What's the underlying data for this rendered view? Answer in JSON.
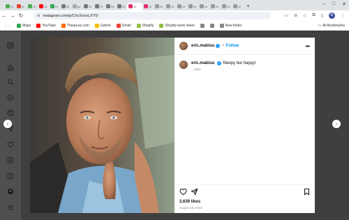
{
  "browser": {
    "tabs": [
      {
        "label": "Gr",
        "color": "#4caf50"
      },
      {
        "label": "In",
        "color": "#ea4335"
      },
      {
        "label": "Gr",
        "color": "#4caf50"
      },
      {
        "label": "Yo",
        "color": "#ff0000"
      },
      {
        "label": "Ui",
        "color": "#34a853"
      },
      {
        "label": "Mi",
        "color": "#777777"
      },
      {
        "label": "go",
        "color": "#aaaaaa"
      },
      {
        "label": "Gr",
        "color": "#777777"
      },
      {
        "label": "Gr",
        "color": "#777777"
      },
      {
        "label": "Sh",
        "color": "#777777"
      },
      {
        "label": "Gr",
        "color": "#777777"
      },
      {
        "label": "Gr",
        "color": "#e1306c",
        "active": true
      },
      {
        "label": "Gr",
        "color": "#e1306c"
      },
      {
        "label": "ch",
        "color": "#999999"
      },
      {
        "label": "ch",
        "color": "#999999"
      },
      {
        "label": "ch",
        "color": "#999999"
      },
      {
        "label": "ch",
        "color": "#999999"
      },
      {
        "label": "ch",
        "color": "#999999"
      },
      {
        "label": "ch",
        "color": "#999999"
      },
      {
        "label": "ch",
        "color": "#999999"
      },
      {
        "label": "ch",
        "color": "#999999"
      }
    ],
    "new_tab": "+",
    "url": "instagram.com/p/ChcSvooLXY5/",
    "bookmarks": [
      {
        "label": "Maps",
        "color": "#34a853"
      },
      {
        "label": "YouTube",
        "color": "#ff0000"
      },
      {
        "label": "Theaurus.com",
        "color": "#ff6d00"
      },
      {
        "label": "Gdrive",
        "color": "#fbbc04"
      },
      {
        "label": "Gmail",
        "color": "#ea4335"
      },
      {
        "label": "Shopify",
        "color": "#95bf47"
      },
      {
        "label": "Shopify work sheet",
        "color": "#95bf47"
      },
      {
        "label": "",
        "color": "#888888"
      },
      {
        "label": "",
        "color": "#888888"
      },
      {
        "label": "New folder",
        "color": "#888888"
      }
    ],
    "all_bookmarks": "All Bookmarks",
    "profile_initial": "M"
  },
  "post": {
    "username": "eric.mabius",
    "follow_label": "Follow",
    "separator": "•",
    "more_label": "•••",
    "caption_user": "eric.mabius",
    "caption_text": "Sleepy but happy!",
    "caption_time": "134w",
    "likes": "2,639 likes",
    "date": "August 29, 2022"
  },
  "colors": {
    "accent": "#0095f6",
    "verified": "#1d9bf0",
    "backdrop": "#5b5b5b"
  }
}
